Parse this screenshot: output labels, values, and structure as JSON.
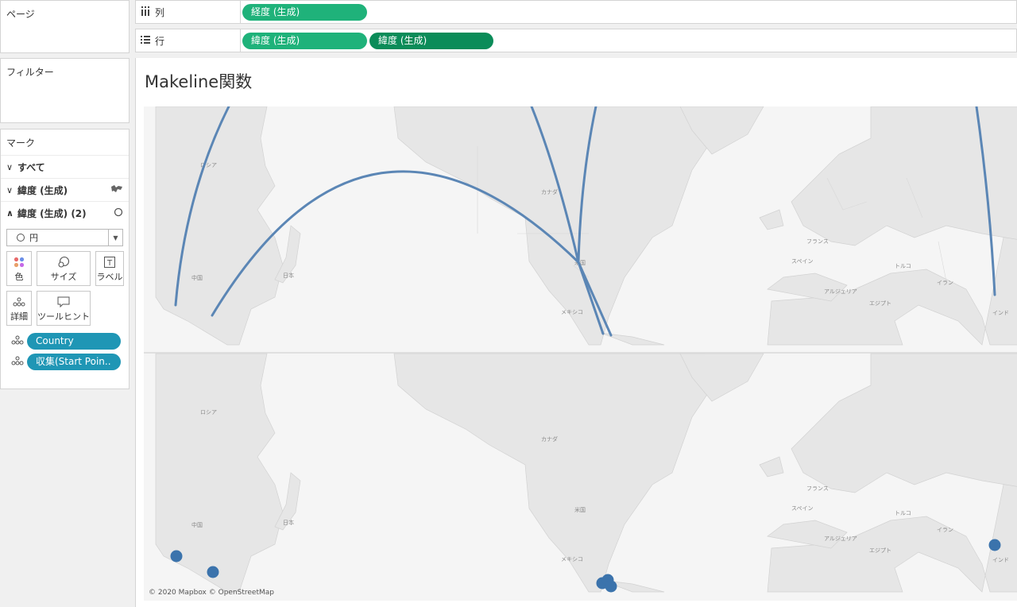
{
  "left_panel": {
    "pages_title": "ページ",
    "filters_title": "フィルター",
    "marks": {
      "title": "マーク",
      "rows": [
        {
          "chev": "∨",
          "label": "すべて"
        },
        {
          "chev": "∨",
          "label": "緯度 (生成)"
        },
        {
          "chev": "∧",
          "label": "緯度 (生成) (2)"
        }
      ],
      "mark_type": "円",
      "cards_row1": [
        "色",
        "サイズ",
        "ラベル"
      ],
      "cards_row2": [
        "詳細",
        "ツールヒント"
      ],
      "detail_pills": [
        "Country",
        "収集(Start Poin.."
      ]
    }
  },
  "shelves": {
    "columns_label": "列",
    "rows_label": "行",
    "columns_pills": [
      "経度 (生成)"
    ],
    "rows_pills": [
      "緯度 (生成)",
      "緯度 (生成)"
    ]
  },
  "viz": {
    "title": "Makeline関数",
    "map_labels": {
      "russia": "ロシア",
      "china": "中国",
      "japan": "日本",
      "canada": "カナダ",
      "usa": "米国",
      "mexico": "メキシコ",
      "france": "フランス",
      "spain": "スペイン",
      "turkey": "トルコ",
      "iran": "イラン",
      "algeria": "アルジェリア",
      "egypt": "エジプト",
      "india": "インド"
    },
    "attribution": "© 2020 Mapbox © OpenStreetMap",
    "line_color": "#5b86b5",
    "point_color": "#3b73ac"
  }
}
